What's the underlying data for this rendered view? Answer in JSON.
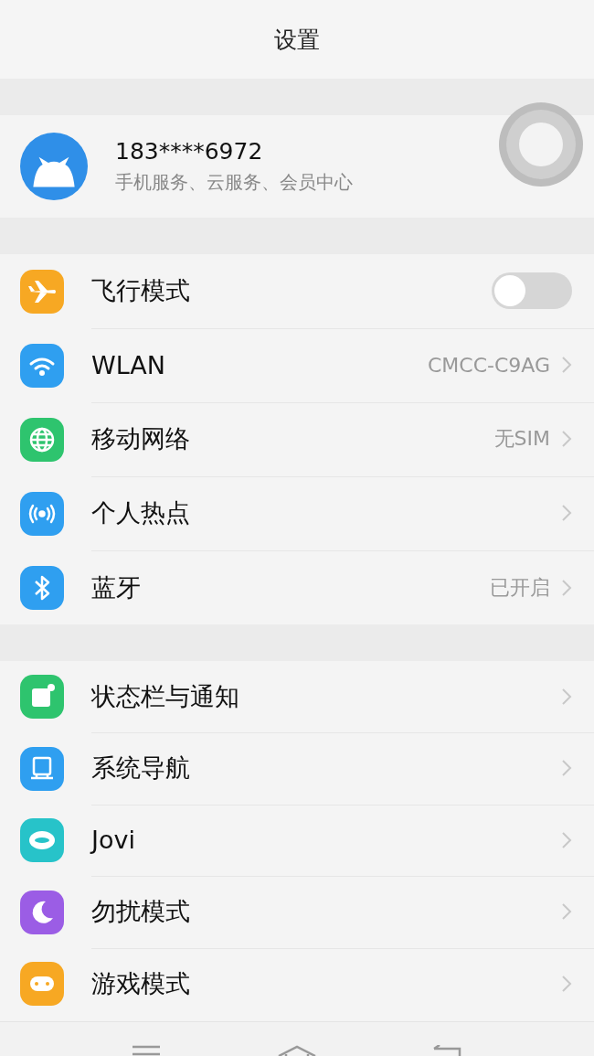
{
  "header": {
    "title": "设置"
  },
  "account": {
    "phone": "183****6972",
    "subtitle": "手机服务、云服务、会员中心"
  },
  "groups": [
    {
      "items": [
        {
          "kind": "toggle",
          "label": "飞行模式",
          "on": false,
          "color": "#f7a823"
        },
        {
          "kind": "link",
          "label": "WLAN",
          "value": "CMCC-C9AG",
          "color": "#2f9ff0"
        },
        {
          "kind": "link",
          "label": "移动网络",
          "value": "无SIM",
          "color": "#2ec46e"
        },
        {
          "kind": "link",
          "label": "个人热点",
          "color": "#2f9ff0"
        },
        {
          "kind": "link",
          "label": "蓝牙",
          "value": "已开启",
          "color": "#2f9ff0"
        }
      ]
    },
    {
      "items": [
        {
          "kind": "link",
          "label": "状态栏与通知",
          "color": "#2ec46e"
        },
        {
          "kind": "link",
          "label": "系统导航",
          "color": "#2f9ff0"
        },
        {
          "kind": "link",
          "label": "Jovi",
          "color": "#27c3c9"
        },
        {
          "kind": "link",
          "label": "勿扰模式",
          "color": "#9b5de5"
        },
        {
          "kind": "link",
          "label": "游戏模式",
          "color": "#f7a823"
        }
      ]
    }
  ]
}
